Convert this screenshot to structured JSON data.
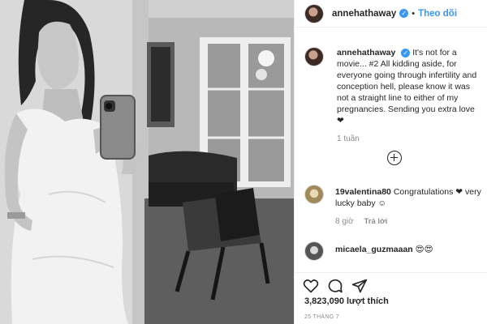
{
  "post": {
    "username": "annehathaway",
    "verified_mark": "✓",
    "dot": "•",
    "follow_label": "Theo dõi"
  },
  "caption": {
    "username": "annehathaway",
    "text": "It's not for a movie... #2 All kidding aside, for everyone going through infertility and conception hell, please know it was not a straight line to either of my pregnancies. Sending you extra love ❤",
    "time": "1 tuần"
  },
  "comments": [
    {
      "username": "19valentina80",
      "text": "Congratulations ❤ very lucky baby ☺",
      "time": "8 giờ",
      "reply_label": "Trả lời"
    },
    {
      "username": "micaela_guzmaaan",
      "text": "😍😍"
    }
  ],
  "likes": {
    "count": "3,823,090",
    "label": "lượt thích"
  },
  "date": "25 THÁNG 7",
  "icons": {
    "like": "heart-icon",
    "comment": "comment-icon",
    "share": "share-icon",
    "load_more": "plus-circle-icon",
    "verified": "verified-badge-icon"
  },
  "colors": {
    "accent": "#3897f0",
    "text": "#262626",
    "muted": "#8e8e8e"
  }
}
